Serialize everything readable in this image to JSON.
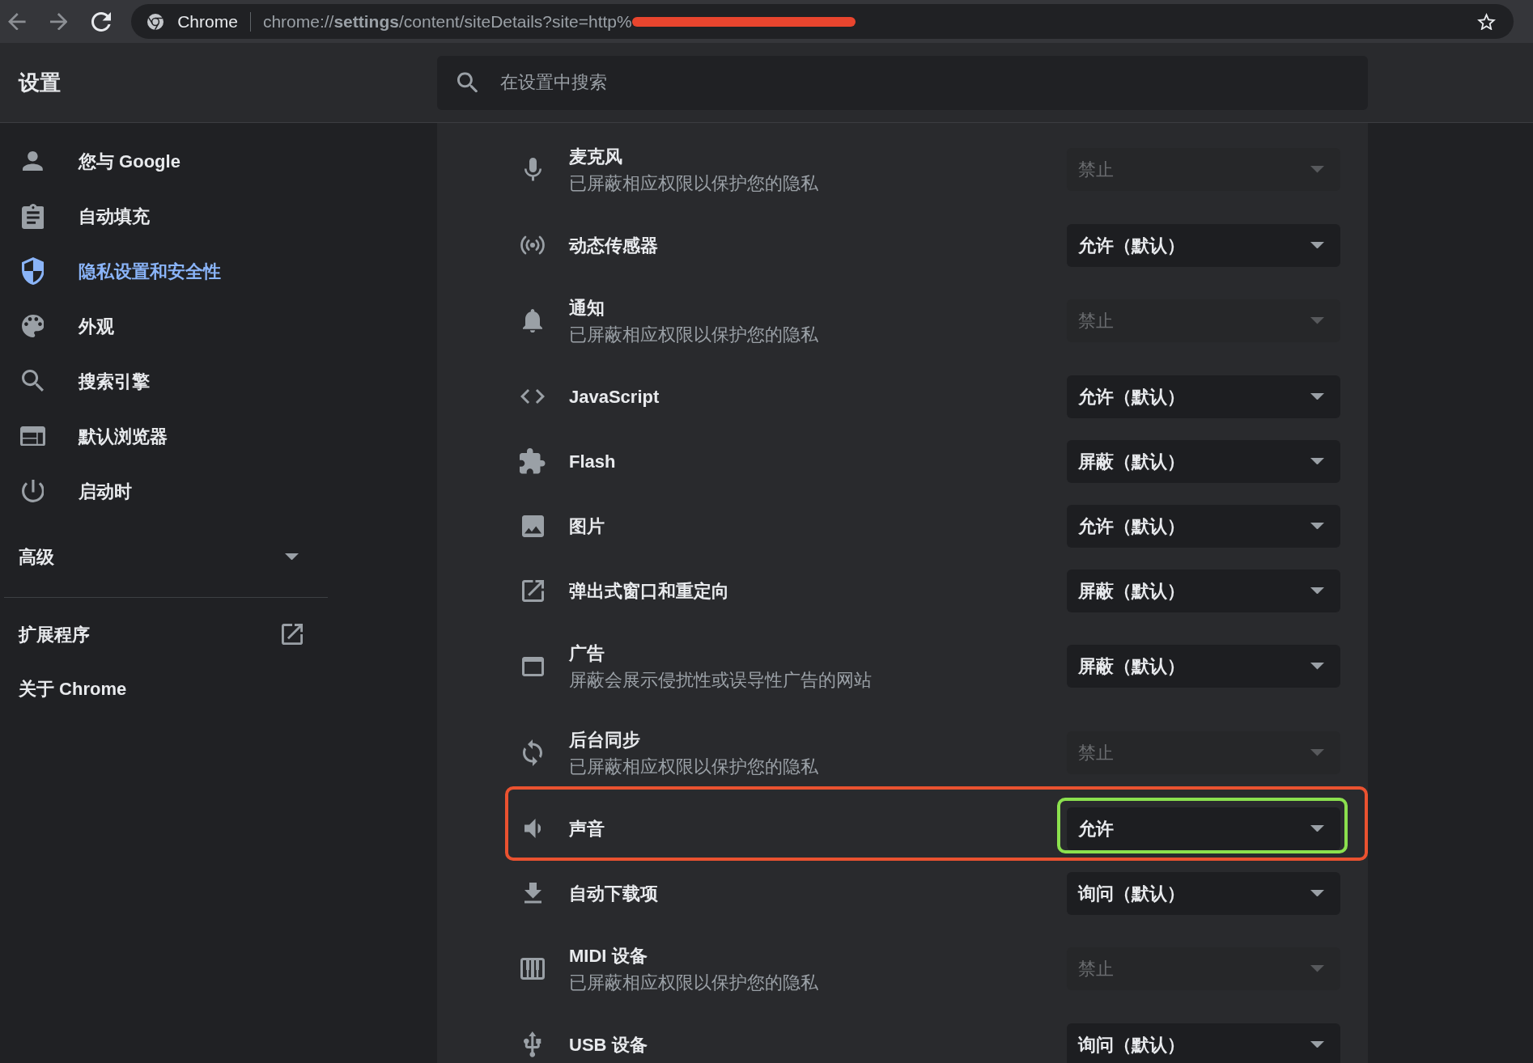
{
  "toolbar": {
    "site_label": "Chrome",
    "url": "chrome://**settings**/content/siteDetails?site=http%",
    "url_redacted": true
  },
  "header": {
    "title": "设置",
    "search": {
      "placeholder": "在设置中搜索"
    }
  },
  "sidebar": {
    "items": [
      {
        "label": "您与 Google",
        "selected": false
      },
      {
        "label": "自动填充",
        "selected": false
      },
      {
        "label": "隐私设置和安全性",
        "selected": true
      },
      {
        "label": "外观",
        "selected": false
      },
      {
        "label": "搜索引擎",
        "selected": false
      },
      {
        "label": "默认浏览器",
        "selected": false
      },
      {
        "label": "启动时",
        "selected": false
      }
    ],
    "advanced": {
      "label": "高级",
      "expanded": false
    },
    "links": [
      {
        "label": "扩展程序",
        "external": true
      },
      {
        "label": "关于 Chrome",
        "external": false
      }
    ]
  },
  "permissions": [
    {
      "title": "麦克风",
      "subtitle": "已屏蔽相应权限以保护您的隐私",
      "value": "禁止",
      "disabled": true,
      "outlined": false,
      "value_outlined": false
    },
    {
      "title": "动态传感器",
      "value": "允许（默认）",
      "disabled": false,
      "outlined": false,
      "value_outlined": false
    },
    {
      "title": "通知",
      "subtitle": "已屏蔽相应权限以保护您的隐私",
      "value": "禁止",
      "disabled": true,
      "outlined": false,
      "value_outlined": false
    },
    {
      "title": "JavaScript",
      "value": "允许（默认）",
      "disabled": false,
      "outlined": false,
      "value_outlined": false
    },
    {
      "title": "Flash",
      "value": "屏蔽（默认）",
      "disabled": false,
      "outlined": false,
      "value_outlined": false
    },
    {
      "title": "图片",
      "value": "允许（默认）",
      "disabled": false,
      "outlined": false,
      "value_outlined": false
    },
    {
      "title": "弹出式窗口和重定向",
      "value": "屏蔽（默认）",
      "disabled": false,
      "outlined": false,
      "value_outlined": false
    },
    {
      "title": "广告",
      "subtitle": "屏蔽会展示侵扰性或误导性广告的网站",
      "value": "屏蔽（默认）",
      "disabled": false,
      "outlined": false,
      "value_outlined": false
    },
    {
      "title": "后台同步",
      "subtitle": "已屏蔽相应权限以保护您的隐私",
      "value": "禁止",
      "disabled": true,
      "outlined": false,
      "value_outlined": false
    },
    {
      "title": "声音",
      "value": "允许",
      "disabled": false,
      "outlined": true,
      "value_outlined": true
    },
    {
      "title": "自动下载项",
      "value": "询问（默认）",
      "disabled": false,
      "outlined": false,
      "value_outlined": false
    },
    {
      "title": "MIDI 设备",
      "subtitle": "已屏蔽相应权限以保护您的隐私",
      "value": "禁止",
      "disabled": true,
      "outlined": false,
      "value_outlined": false
    },
    {
      "title": "USB 设备",
      "value": "询问（默认）",
      "disabled": false,
      "outlined": false,
      "value_outlined": false
    }
  ]
}
